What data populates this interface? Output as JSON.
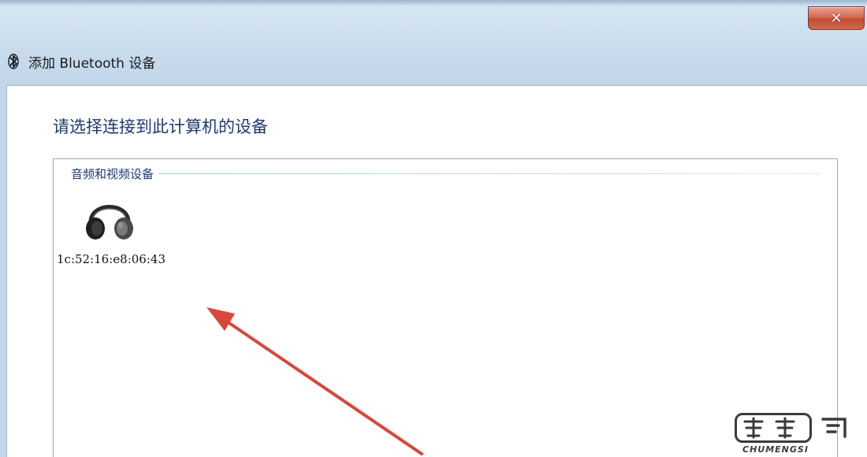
{
  "window": {
    "title": "添加 Bluetooth 设备",
    "close_label": "✕"
  },
  "main": {
    "instruction": "请选择连接到此计算机的设备",
    "group_label": "音频和视频设备",
    "devices": [
      {
        "name": "1c:52:16:e8:06:43",
        "icon": "headphones-icon"
      }
    ]
  },
  "annotation": {
    "arrow_color": "#d8473a"
  },
  "watermark": {
    "text": "CHUMENGSI",
    "logo_text": "楚萌司"
  }
}
